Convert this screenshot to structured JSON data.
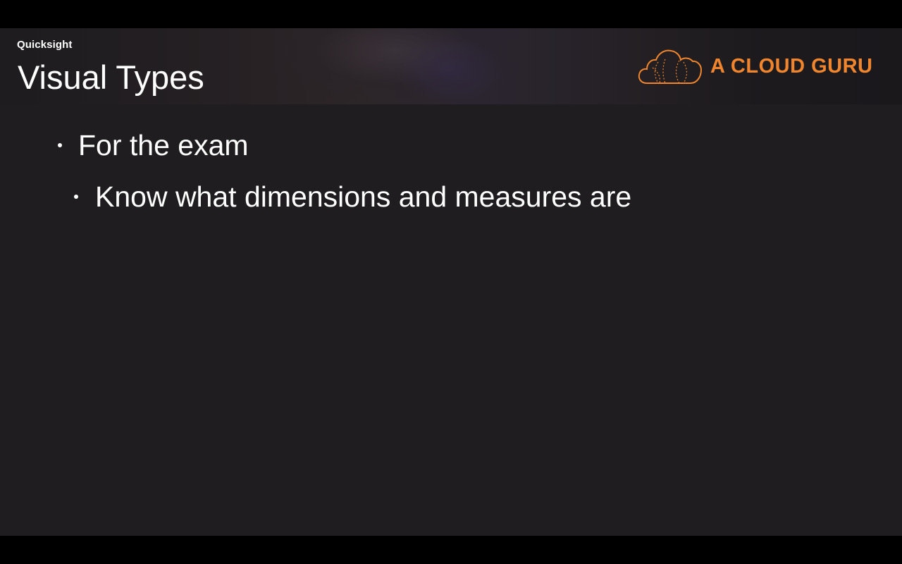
{
  "slide": {
    "course_label": "Quicksight",
    "title": "Visual Types",
    "logo_text": "A CLOUD GURU",
    "bullets": [
      {
        "level": 1,
        "text": "For the exam"
      },
      {
        "level": 2,
        "text": "Know what dimensions and measures are"
      }
    ]
  },
  "colors": {
    "letterbox": "#000000",
    "slide_background": "#1f1d20",
    "text": "#ffffff",
    "brand_accent": "#f0852d"
  },
  "icons": {
    "logo": "cloud-logo-icon",
    "bullet": "bullet-dot-icon"
  }
}
